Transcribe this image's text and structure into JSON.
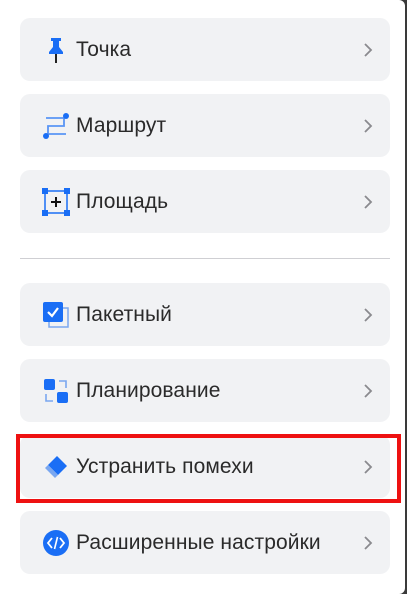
{
  "menu": {
    "items": [
      {
        "label": "Точка",
        "icon": "pin-icon"
      },
      {
        "label": "Маршрут",
        "icon": "route-icon"
      },
      {
        "label": "Площадь",
        "icon": "area-icon"
      },
      {
        "label": "Пакетный",
        "icon": "batch-checkbox-icon"
      },
      {
        "label": "Планирование",
        "icon": "planning-icon"
      },
      {
        "label": "Устранить помехи",
        "icon": "eraser-icon"
      },
      {
        "label": "Расширенные настройки",
        "icon": "code-icon"
      }
    ],
    "highlighted_item": "Устранить помехи"
  },
  "colors": {
    "accent": "#1a6ef5",
    "item_bg": "#f1f2f4",
    "highlight": "#ee1111",
    "text": "#2a2a2a",
    "chevron": "#8a8a8e"
  }
}
